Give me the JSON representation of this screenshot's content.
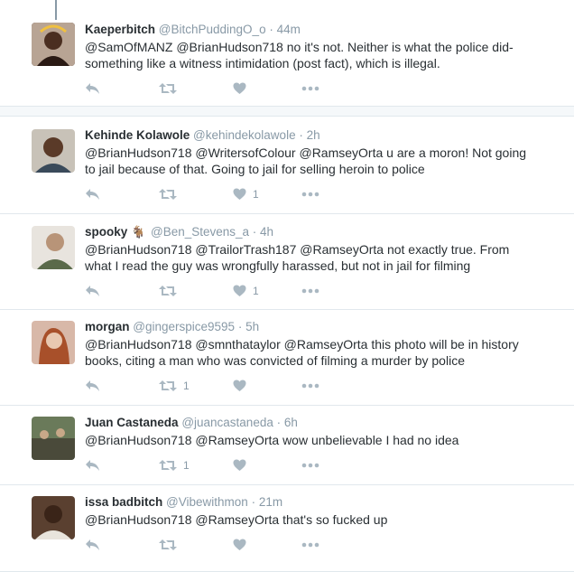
{
  "colors": {
    "accent": "#1da1f2",
    "text": "#292f33",
    "muted": "#8899a6",
    "icon": "#aab8c2",
    "divider": "#e1e8ed"
  },
  "tweets": [
    {
      "name": "Kaeperbitch",
      "handle": "@BitchPuddingO_o",
      "sep": "·",
      "time": "44m",
      "lines": [
        "@SamOfMANZ @BrianHudson718 no it's not. Neither is what the police did-",
        "something like a witness intimidation (post fact), which is illegal."
      ],
      "retweets": "",
      "likes": "",
      "icons": [
        "reply-icon",
        "retweet-icon",
        "like-icon",
        "more-icon"
      ]
    },
    {
      "name": "Kehinde Kolawole",
      "handle": "@kehindekolawole",
      "sep": "·",
      "time": "2h",
      "lines": [
        "@BrianHudson718 @WritersofColour @RamseyOrta u are a moron! Not going",
        "to jail because of that. Going to jail for selling heroin to police"
      ],
      "retweets": "",
      "likes": "1"
    },
    {
      "name": "spooky",
      "emoji": "🐐",
      "handle": "@Ben_Stevens_a",
      "sep": "·",
      "time": "4h",
      "lines": [
        "@BrianHudson718 @TrailorTrash187 @RamseyOrta not exactly true. From",
        "what I read the guy was wrongfully harassed, but not in jail for filming"
      ],
      "retweets": "",
      "likes": "1"
    },
    {
      "name": "morgan",
      "handle": "@gingerspice9595",
      "sep": "·",
      "time": "5h",
      "lines": [
        "@BrianHudson718 @smnthataylor @RamseyOrta this photo will be in history",
        "books, citing a man who was convicted of filming a murder by police"
      ],
      "retweets": "1",
      "likes": ""
    },
    {
      "name": "Juan Castaneda",
      "handle": "@juancastaneda",
      "sep": "·",
      "time": "6h",
      "lines": [
        "@BrianHudson718 @RamseyOrta wow unbelievable I had no idea"
      ],
      "retweets": "1",
      "likes": ""
    },
    {
      "name": "issa badbitch",
      "handle": "@Vibewithmon",
      "sep": "·",
      "time": "21m",
      "lines": [
        "@BrianHudson718 @RamseyOrta that's so fucked up"
      ],
      "retweets": "",
      "likes": ""
    }
  ]
}
